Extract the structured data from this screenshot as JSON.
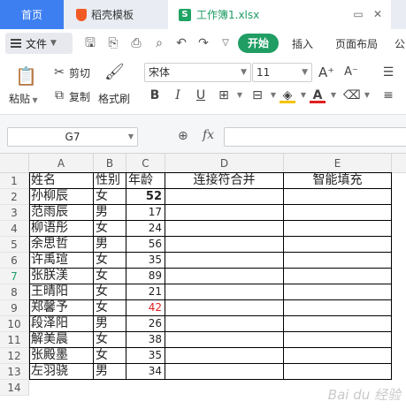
{
  "tabs": {
    "home": "首页",
    "template": "稻壳模板",
    "document": "工作簿1.xlsx"
  },
  "menu": {
    "file": "文件",
    "start": "开始",
    "insert": "插入",
    "layout": "页面布局",
    "more": "公"
  },
  "ribbon": {
    "paste": "粘贴",
    "cut": "剪切",
    "copy": "复制",
    "format_painter": "格式刷",
    "font_name": "宋体",
    "font_size": "11",
    "bold": "B",
    "italic": "I",
    "underline": "U"
  },
  "formula_bar": {
    "cell_ref": "G7",
    "fx": "fx",
    "value": ""
  },
  "sheet": {
    "columns": [
      "A",
      "B",
      "C",
      "D",
      "E"
    ],
    "row_numbers": [
      "1",
      "2",
      "3",
      "4",
      "5",
      "6",
      "7",
      "8",
      "9",
      "10",
      "11",
      "12",
      "13",
      "14"
    ],
    "selected_row": "7",
    "header": [
      "姓名",
      "性别",
      "年龄",
      "连接符合并",
      "智能填充"
    ],
    "rows": [
      {
        "name": "孙柳辰",
        "gender": "女",
        "age": "52"
      },
      {
        "name": "范雨辰",
        "gender": "男",
        "age": "17"
      },
      {
        "name": "柳语彤",
        "gender": "女",
        "age": "24"
      },
      {
        "name": "余思哲",
        "gender": "男",
        "age": "56"
      },
      {
        "name": "许禹瑄",
        "gender": "女",
        "age": "35"
      },
      {
        "name": "张朕渼",
        "gender": "女",
        "age": "89"
      },
      {
        "name": "王晴阳",
        "gender": "女",
        "age": "21"
      },
      {
        "name": "郑馨予",
        "gender": "女",
        "age": "42"
      },
      {
        "name": "段泽阳",
        "gender": "男",
        "age": "26"
      },
      {
        "name": "解美晨",
        "gender": "女",
        "age": "38"
      },
      {
        "name": "张殿墨",
        "gender": "女",
        "age": "35"
      },
      {
        "name": "左羽骁",
        "gender": "男",
        "age": "34"
      }
    ],
    "red_age_row": 8,
    "bold_age_row": 1,
    "red_color": "#e02020",
    "accent_green": "#1f9d63"
  },
  "watermark": "Bai du 经验"
}
